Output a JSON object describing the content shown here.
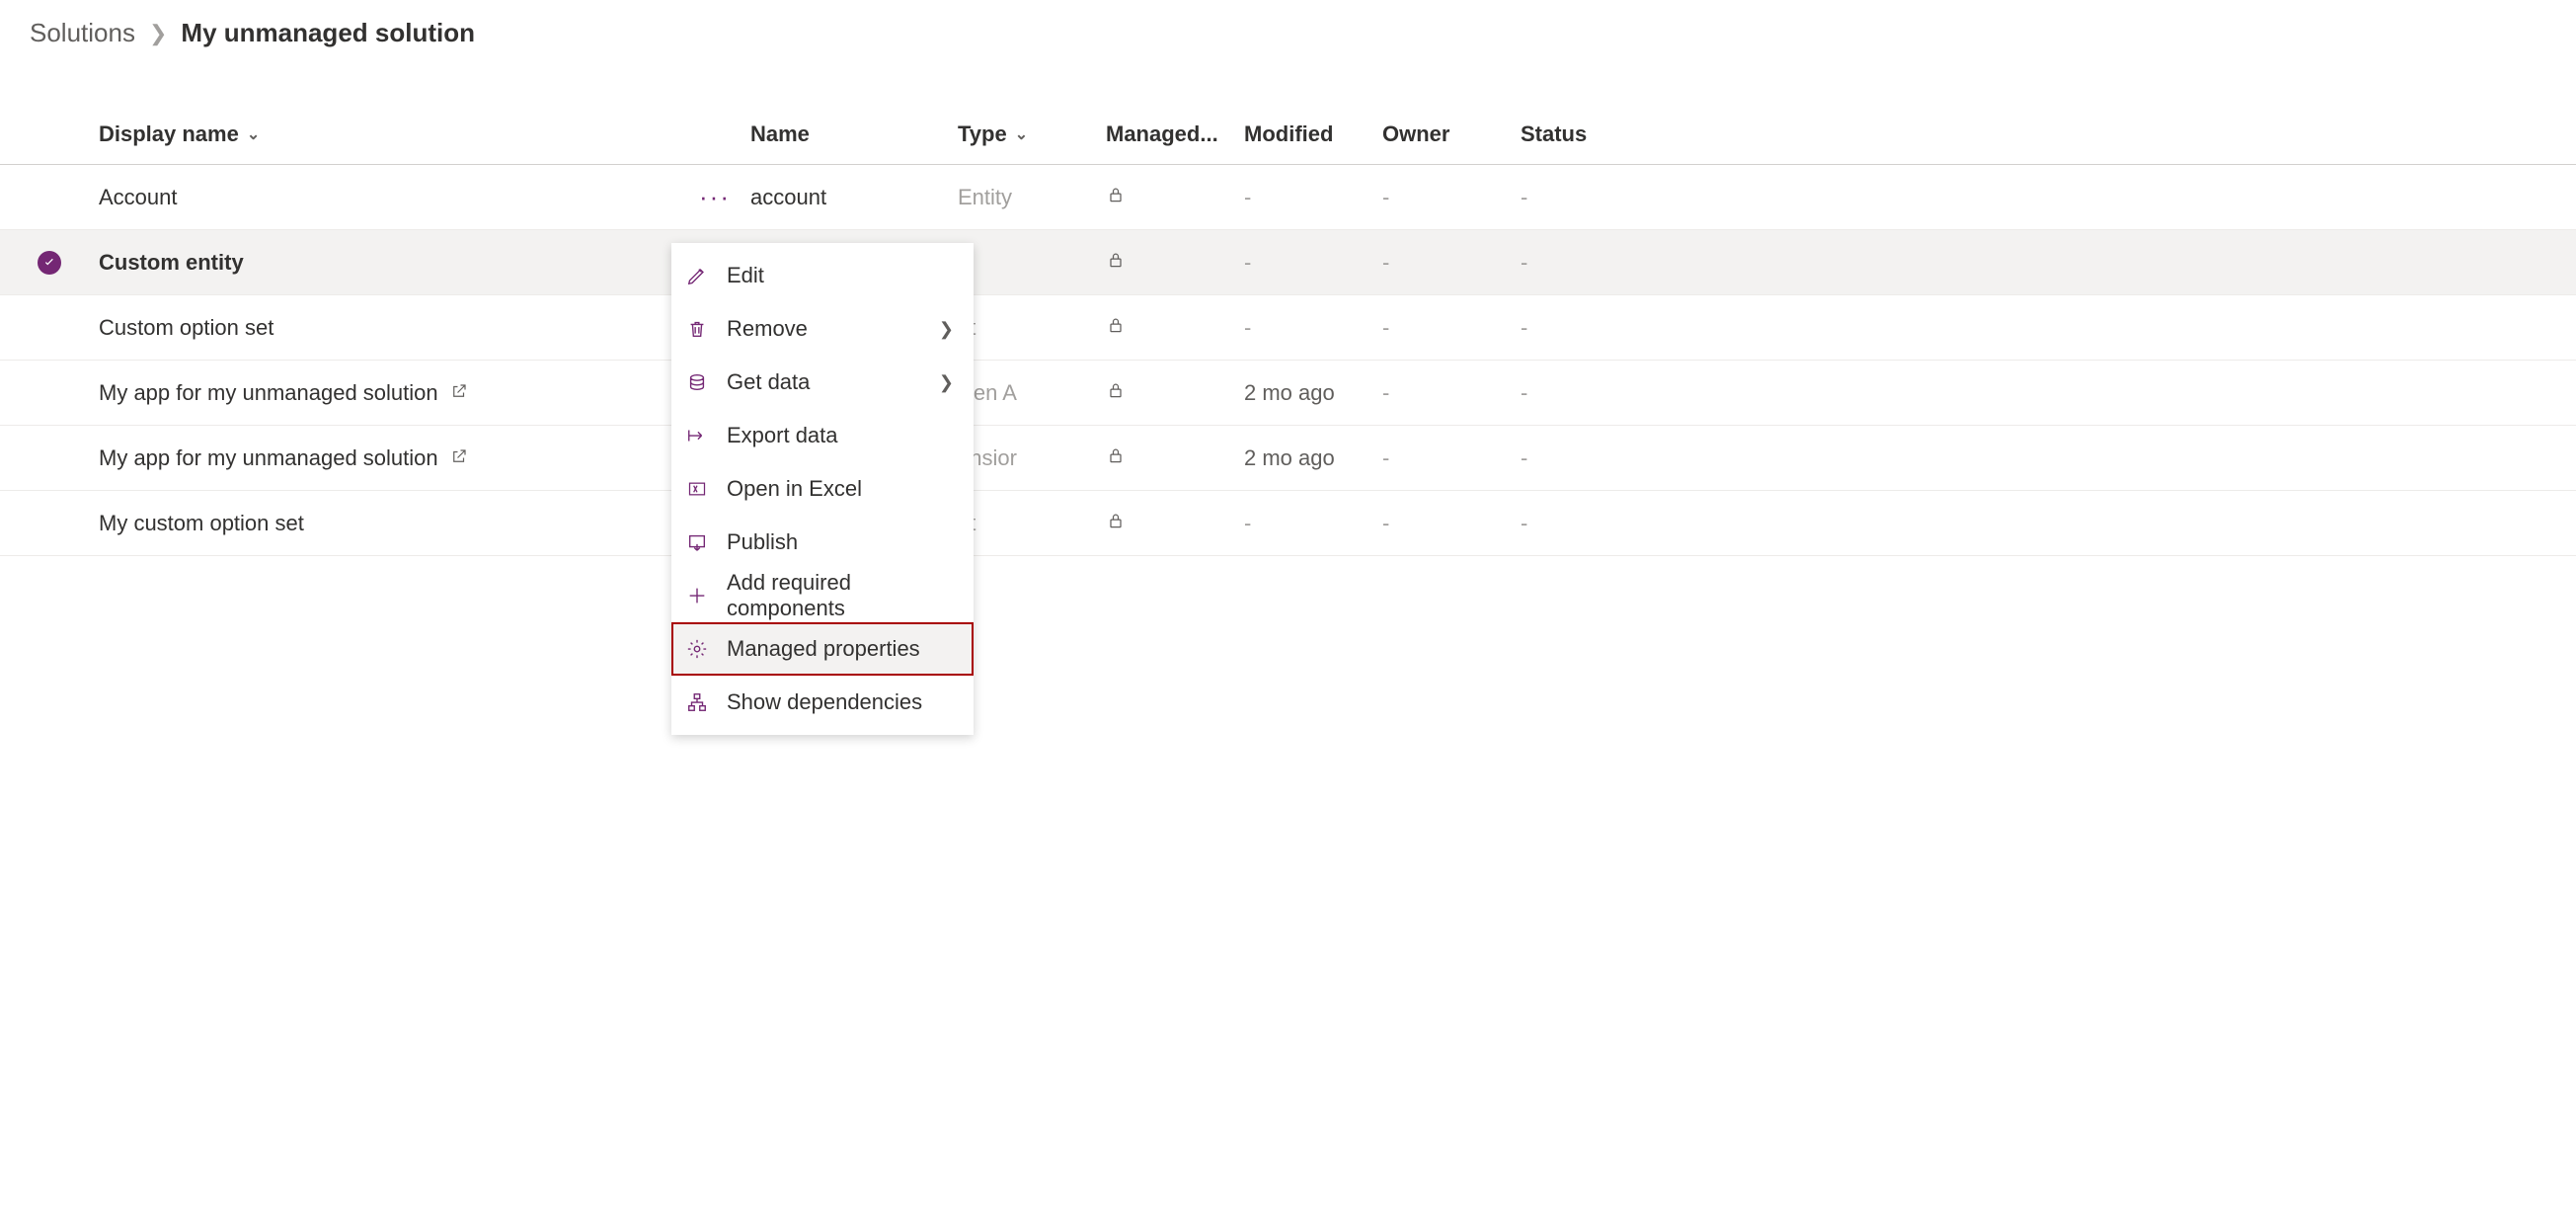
{
  "breadcrumb": {
    "root": "Solutions",
    "current": "My unmanaged solution"
  },
  "columns": {
    "displayName": "Display name",
    "name": "Name",
    "type": "Type",
    "managed": "Managed...",
    "modified": "Modified",
    "owner": "Owner",
    "status": "Status"
  },
  "rows": [
    {
      "selected": false,
      "display": "Account",
      "external": false,
      "name": "account",
      "type": "Entity",
      "managed_lock": true,
      "modified": "-",
      "owner": "-",
      "status": "-"
    },
    {
      "selected": true,
      "display": "Custom entity",
      "external": false,
      "name": "",
      "type": "",
      "managed_lock": true,
      "modified": "-",
      "owner": "-",
      "status": "-"
    },
    {
      "selected": false,
      "display": "Custom option set",
      "external": false,
      "name": "",
      "type": "et",
      "managed_lock": true,
      "modified": "-",
      "owner": "-",
      "status": "-"
    },
    {
      "selected": false,
      "display": "My app for my unmanaged solution",
      "external": true,
      "name": "",
      "type": "iven A",
      "managed_lock": true,
      "modified": "2 mo ago",
      "owner": "-",
      "status": "-"
    },
    {
      "selected": false,
      "display": "My app for my unmanaged solution",
      "external": true,
      "name": "",
      "type": "ensior",
      "managed_lock": true,
      "modified": "2 mo ago",
      "owner": "-",
      "status": "-"
    },
    {
      "selected": false,
      "display": "My custom option set",
      "external": false,
      "name": "",
      "type": "et",
      "managed_lock": true,
      "modified": "-",
      "owner": "-",
      "status": "-"
    }
  ],
  "menu": {
    "items": [
      {
        "icon": "edit",
        "label": "Edit",
        "submenu": false
      },
      {
        "icon": "delete",
        "label": "Remove",
        "submenu": true
      },
      {
        "icon": "data",
        "label": "Get data",
        "submenu": true
      },
      {
        "icon": "export",
        "label": "Export data",
        "submenu": false
      },
      {
        "icon": "excel",
        "label": "Open in Excel",
        "submenu": false
      },
      {
        "icon": "publish",
        "label": "Publish",
        "submenu": false
      },
      {
        "icon": "plus",
        "label": "Add required components",
        "submenu": false
      },
      {
        "icon": "gear",
        "label": "Managed properties",
        "submenu": false,
        "highlight": true
      },
      {
        "icon": "tree",
        "label": "Show dependencies",
        "submenu": false
      }
    ]
  }
}
